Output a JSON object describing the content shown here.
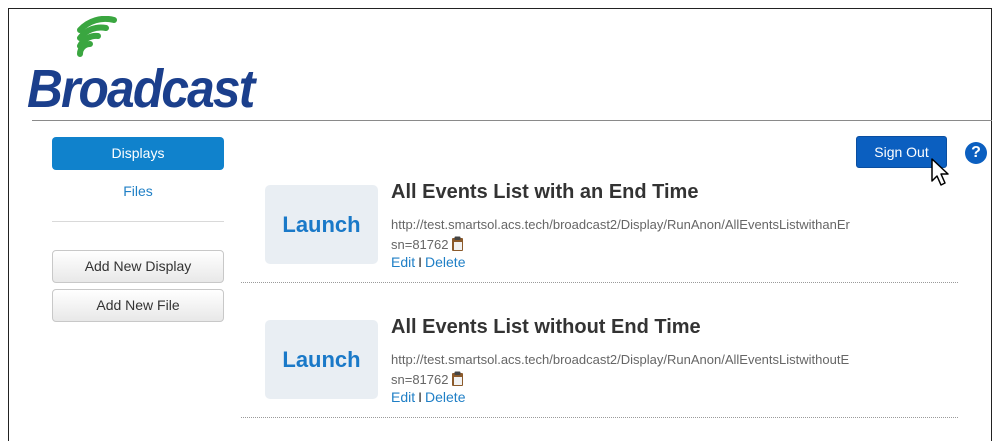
{
  "app": {
    "logo_text": "Broadcast"
  },
  "sidebar": {
    "nav": [
      {
        "label": "Displays",
        "active": true
      },
      {
        "label": "Files",
        "active": false
      }
    ],
    "buttons": [
      {
        "label": "Add New Display"
      },
      {
        "label": "Add New File"
      }
    ]
  },
  "header": {
    "signout_label": "Sign Out",
    "help_label": "?"
  },
  "displays": [
    {
      "launch_label": "Launch",
      "title": "All Events List with an End Time",
      "url_line1": "http://test.smartsol.acs.tech/broadcast2/Display/RunAnon/AllEventsListwithanEr",
      "url_line2": "sn=81762",
      "edit_label": "Edit",
      "separator": "I",
      "delete_label": "Delete"
    },
    {
      "launch_label": "Launch",
      "title": "All Events List without End Time",
      "url_line1": "http://test.smartsol.acs.tech/broadcast2/Display/RunAnon/AllEventsListwithoutE",
      "url_line2": "sn=81762",
      "edit_label": "Edit",
      "separator": "I",
      "delete_label": "Delete"
    }
  ],
  "colors": {
    "brand_blue": "#1b3f8c",
    "logo_green": "#3aa640",
    "accent_blue": "#1082cc",
    "signout_blue": "#0b5fc0",
    "link_blue": "#1f7fc6"
  },
  "icons": {
    "logo_mark": "signal-waves-icon",
    "copy": "clipboard-icon",
    "cursor": "mouse-pointer-icon",
    "help": "help-icon"
  }
}
